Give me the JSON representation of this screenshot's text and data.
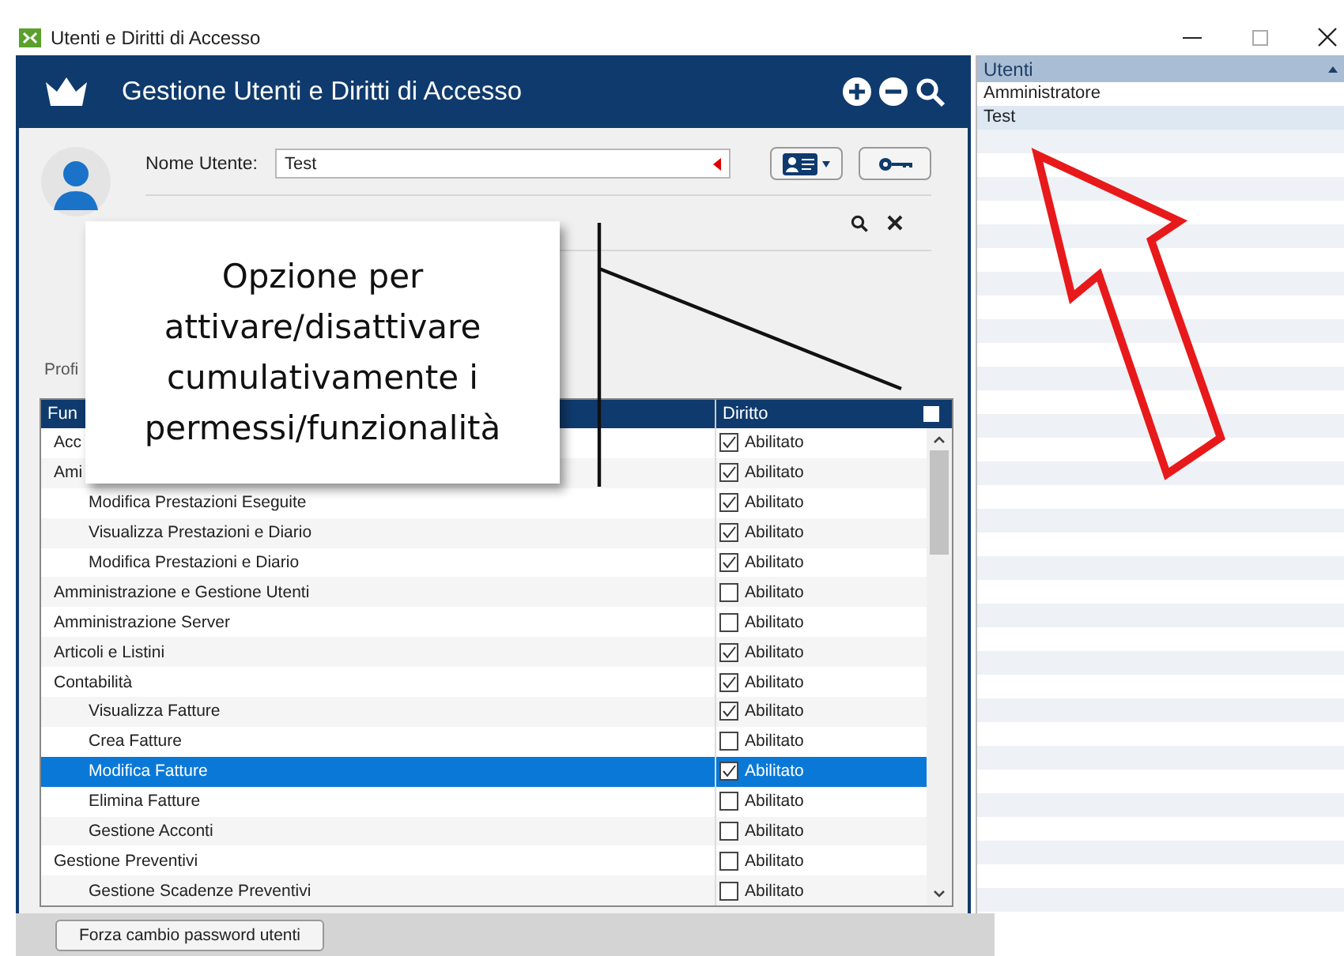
{
  "window": {
    "title": "Utenti e Diritti di Accesso"
  },
  "header": {
    "title": "Gestione Utenti e Diritti di Accesso"
  },
  "user_form": {
    "label": "Nome Utente:",
    "value": "Test"
  },
  "profile_label": "Profi",
  "table": {
    "columns": [
      "Fun",
      "Diritto"
    ],
    "all_checked": false,
    "rows": [
      {
        "label": "Acc",
        "right": "Abilitato",
        "checked": true,
        "selected": false
      },
      {
        "label": "Ami",
        "right": "Abilitato",
        "checked": true,
        "selected": false,
        "children": [
          {
            "label": "Modifica Prestazioni Eseguite",
            "right": "Abilitato",
            "checked": true,
            "selected": false
          },
          {
            "label": "Visualizza Prestazioni e Diario",
            "right": "Abilitato",
            "checked": true,
            "selected": false
          },
          {
            "label": "Modifica Prestazioni e Diario",
            "right": "Abilitato",
            "checked": true,
            "selected": false
          }
        ]
      },
      {
        "label": "Amministrazione e Gestione Utenti",
        "right": "Abilitato",
        "checked": false,
        "selected": false
      },
      {
        "label": "Amministrazione Server",
        "right": "Abilitato",
        "checked": false,
        "selected": false
      },
      {
        "label": "Articoli e Listini",
        "right": "Abilitato",
        "checked": true,
        "selected": false
      },
      {
        "label": "Contabilità",
        "right": "Abilitato",
        "checked": true,
        "selected": false,
        "children": [
          {
            "label": "Visualizza Fatture",
            "right": "Abilitato",
            "checked": true,
            "selected": false
          },
          {
            "label": "Crea Fatture",
            "right": "Abilitato",
            "checked": false,
            "selected": false
          },
          {
            "label": "Modifica Fatture",
            "right": "Abilitato",
            "checked": true,
            "selected": true
          },
          {
            "label": "Elimina Fatture",
            "right": "Abilitato",
            "checked": false,
            "selected": false
          },
          {
            "label": "Gestione Acconti",
            "right": "Abilitato",
            "checked": false,
            "selected": false
          }
        ]
      },
      {
        "label": "Gestione Preventivi",
        "right": "Abilitato",
        "checked": false,
        "selected": false,
        "children": [
          {
            "label": "Gestione Scadenze Preventivi",
            "right": "Abilitato",
            "checked": false,
            "selected": false
          }
        ]
      }
    ]
  },
  "callout": {
    "text": "Opzione per attivare/disattivare cumulativamente i permessi/funzionalità"
  },
  "users_panel": {
    "title": "Utenti",
    "items": [
      {
        "name": "Amministratore",
        "selected": false
      },
      {
        "name": "Test",
        "selected": true
      }
    ]
  },
  "footer": {
    "button": "Forza cambio password utenti"
  }
}
